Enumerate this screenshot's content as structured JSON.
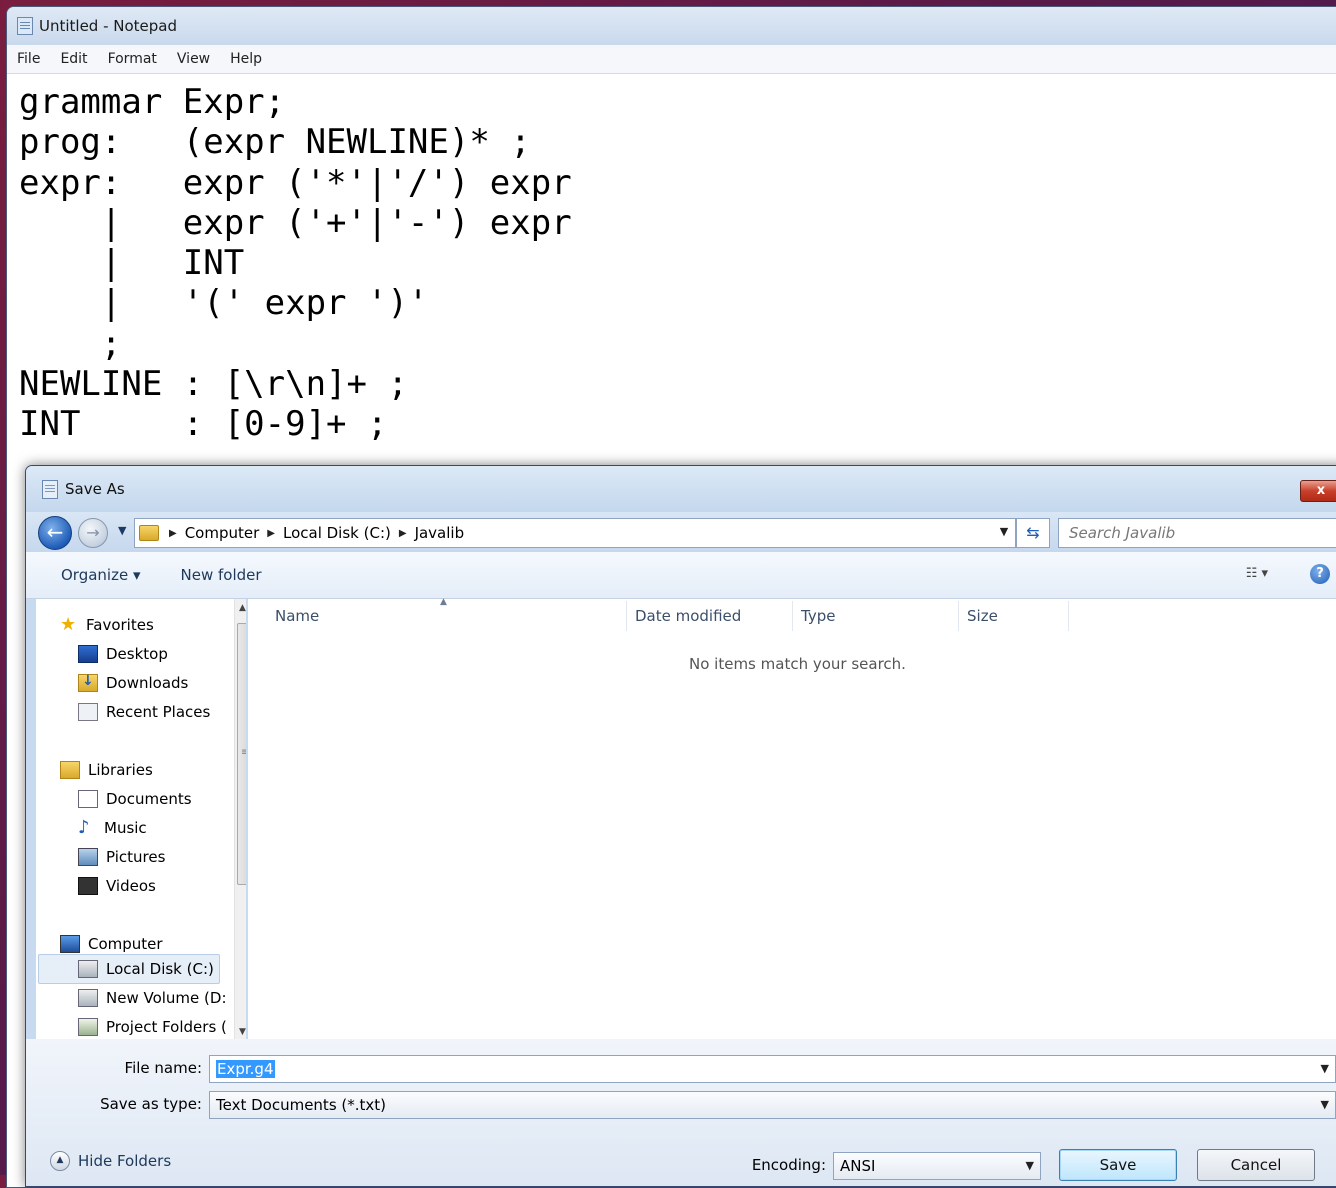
{
  "notepad": {
    "title": "Untitled - Notepad",
    "menu": [
      "File",
      "Edit",
      "Format",
      "View",
      "Help"
    ],
    "content": "grammar Expr;\nprog:   (expr NEWLINE)* ;\nexpr:   expr ('*'|'/') expr\n    |   expr ('+'|'-') expr\n    |   INT\n    |   '(' expr ')'\n    ;\nNEWLINE : [\\r\\n]+ ;\nINT     : [0-9]+ ;"
  },
  "dialog": {
    "title": "Save As",
    "close_label": "x",
    "breadcrumb": [
      "Computer",
      "Local Disk (C:)",
      "Javalib"
    ],
    "search_placeholder": "Search Javalib",
    "toolbar": {
      "organize": "Organize ▾",
      "new_folder": "New folder"
    },
    "nav": {
      "favorites": {
        "label": "Favorites",
        "items": [
          "Desktop",
          "Downloads",
          "Recent Places"
        ]
      },
      "libraries": {
        "label": "Libraries",
        "items": [
          "Documents",
          "Music",
          "Pictures",
          "Videos"
        ]
      },
      "computer": {
        "label": "Computer",
        "items": [
          "Local Disk (C:)",
          "New Volume (D:",
          "Project Folders ("
        ]
      },
      "selected": "Local Disk (C:)"
    },
    "columns": [
      "Name",
      "Date modified",
      "Type",
      "Size"
    ],
    "empty_message": "No items match your search.",
    "file_name_label": "File name:",
    "file_name_value": "Expr.g4",
    "save_type_label": "Save as type:",
    "save_type_value": "Text Documents (*.txt)",
    "encoding_label": "Encoding:",
    "encoding_value": "ANSI",
    "save_button": "Save",
    "cancel_button": "Cancel",
    "hide_folders": "Hide Folders"
  }
}
